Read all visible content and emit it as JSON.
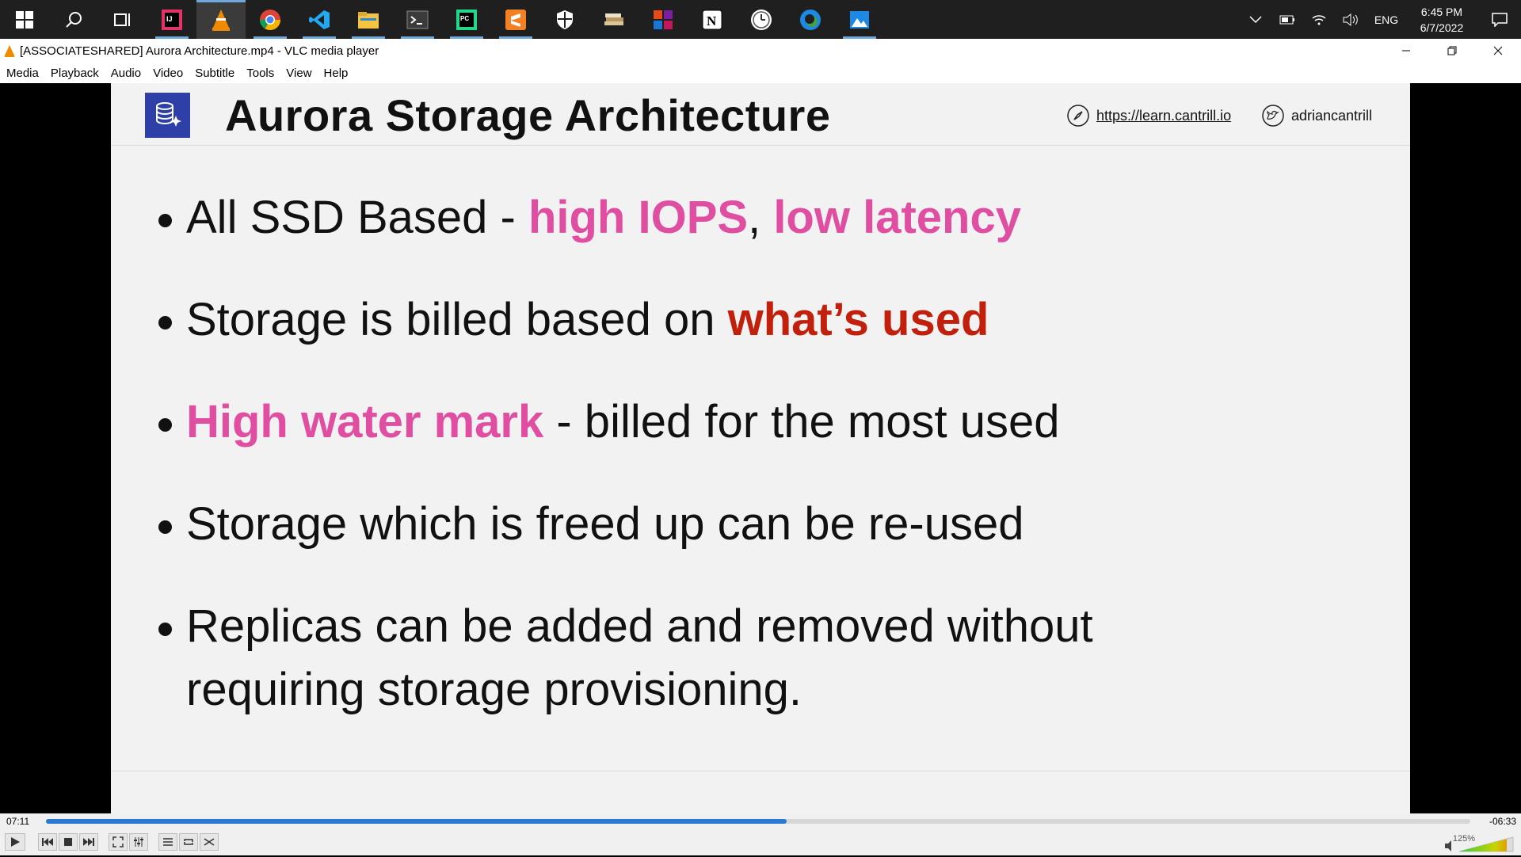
{
  "taskbar": {
    "apps": [
      "start-icon",
      "search-icon",
      "task-view-icon",
      "intellij-icon",
      "vlc-icon",
      "chrome-icon",
      "vscode-icon",
      "file-explorer-icon",
      "terminal-icon",
      "pycharm-icon",
      "sublime-icon",
      "security-icon",
      "books-icon",
      "office-icon",
      "notion-icon",
      "clock-app-icon",
      "edge-icon",
      "photos-icon"
    ],
    "tray": {
      "language": "ENG",
      "time": "6:45 PM",
      "date": "6/7/2022"
    }
  },
  "window": {
    "title": "[ASSOCIATESHARED] Aurora Architecture.mp4 - VLC media player"
  },
  "menu": [
    "Media",
    "Playback",
    "Audio",
    "Video",
    "Subtitle",
    "Tools",
    "View",
    "Help"
  ],
  "slide": {
    "title": "Aurora Storage Architecture",
    "link": "https://learn.cantrill.io",
    "handle": "adriancantrill",
    "bullets": {
      "b1_a": "All SSD Based - ",
      "b1_b": "high IOPS",
      "b1_c": ", ",
      "b1_d": "low latency",
      "b2_a": "Storage is billed based on ",
      "b2_b": "what’s used",
      "b3_a": "High water mark",
      "b3_b": " - billed for the most used",
      "b4": "Storage which is freed up can be re-used",
      "b5": "Replicas can be added and removed without requiring storage provisioning."
    },
    "colors": {
      "pink": "#e04ea2",
      "red": "#c0200c",
      "logo": "#2e3fa7"
    }
  },
  "player": {
    "elapsed": "07:11",
    "remaining": "-06:33",
    "progress_fraction": 0.52,
    "volume": "125%"
  }
}
